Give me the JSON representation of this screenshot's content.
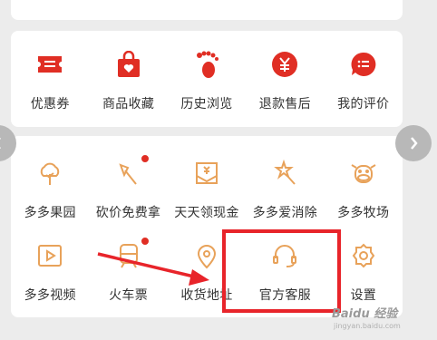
{
  "colors": {
    "accent": "#e02e24",
    "outline_icon": "#e8a25a",
    "highlight": "#e8242a"
  },
  "order_section": {
    "items": [
      {
        "label": "优惠券",
        "icon": "coupon-icon"
      },
      {
        "label": "商品收藏",
        "icon": "shopping-bag-heart-icon"
      },
      {
        "label": "历史浏览",
        "icon": "footprint-icon"
      },
      {
        "label": "退款售后",
        "icon": "yuan-coin-icon"
      },
      {
        "label": "我的评价",
        "icon": "comment-icon"
      }
    ]
  },
  "services_section": {
    "row1": [
      {
        "label": "多多果园",
        "icon": "tree-icon",
        "badge": false
      },
      {
        "label": "砍价免费拿",
        "icon": "axe-icon",
        "badge": true
      },
      {
        "label": "天天领现金",
        "icon": "cash-envelope-icon",
        "badge": false
      },
      {
        "label": "多多爱消除",
        "icon": "star-wand-icon",
        "badge": false
      },
      {
        "label": "多多牧场",
        "icon": "cow-icon",
        "badge": false
      }
    ],
    "row2": [
      {
        "label": "多多视频",
        "icon": "play-video-icon",
        "badge": false
      },
      {
        "label": "火车票",
        "icon": "train-icon",
        "badge": true
      },
      {
        "label": "收货地址",
        "icon": "location-pin-icon",
        "badge": false
      },
      {
        "label": "官方客服",
        "icon": "headset-icon",
        "badge": false
      },
      {
        "label": "设置",
        "icon": "gear-icon",
        "badge": false
      }
    ]
  },
  "nav": {
    "prev_icon": "chevron-left-icon",
    "next_icon": "chevron-right-icon"
  },
  "watermark": {
    "text": "Baidu 经验",
    "sub": "jingyan.baidu.com"
  }
}
